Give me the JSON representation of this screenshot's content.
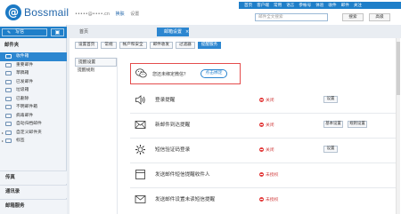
{
  "header": {
    "brand": "Bossmail",
    "account_email": "•••••@••••.cn",
    "switch_link": "换肤",
    "settings_link": "设置",
    "nav_items": [
      "首页",
      "客户端",
      "常用",
      "语言",
      "参帐号",
      "体验",
      "收件",
      "邮件",
      "关注"
    ],
    "search_placeholder": "邮件全文搜索",
    "search_button": "搜索",
    "advanced_button": "高级"
  },
  "sidebar": {
    "compose_label": "写信",
    "mail_section": "邮件夹",
    "folders": [
      {
        "label": "收件箱",
        "active": true
      },
      {
        "label": "重要邮件",
        "active": false
      },
      {
        "label": "草稿箱",
        "active": false
      },
      {
        "label": "已发邮件",
        "active": false
      },
      {
        "label": "垃圾箱",
        "active": false
      },
      {
        "label": "已删除",
        "active": false
      },
      {
        "label": "不明邮件箱",
        "active": false
      },
      {
        "label": "病毒邮件",
        "active": false
      },
      {
        "label": "自动归档邮件",
        "active": false
      },
      {
        "label": "自定义邮件夹",
        "active": false
      },
      {
        "label": "标签",
        "active": false
      }
    ],
    "footer": [
      "传真",
      "通讯录",
      "邮箱服务"
    ]
  },
  "tabs": {
    "home": "首页",
    "active": "邮箱设置",
    "close": "×"
  },
  "settings": {
    "subtabs": [
      "设置首页",
      "常规",
      "帐户和安全",
      "邮件收发",
      "过滤器",
      "提醒服务"
    ],
    "active_subtab": 5,
    "left_nav": [
      "提醒设置",
      "提醒规则"
    ],
    "wechat": {
      "text": "您还未绑定微信？",
      "button": "点击绑定"
    },
    "rows": [
      {
        "title": "登录提醒",
        "status": "关闭",
        "buttons": [
          "设置"
        ],
        "icon": "speaker-icon"
      },
      {
        "title": "新邮件到达提醒",
        "status": "关闭",
        "buttons": [
          "基本设置",
          "规则设置"
        ],
        "icon": "mail-icon"
      },
      {
        "title": "短信验证码登录",
        "status": "关闭",
        "buttons": [
          "设置"
        ],
        "icon": "gear-icon"
      },
      {
        "title": "发送邮件短信提醒收件人",
        "status": "未授权",
        "buttons": [],
        "icon": "window-icon"
      },
      {
        "title": "发送邮件设置未读短信提醒",
        "status": "未授权",
        "buttons": [],
        "icon": "mail-send-icon"
      }
    ]
  },
  "colors": {
    "accent": "#2c86d0",
    "alert": "#e33b3b"
  }
}
